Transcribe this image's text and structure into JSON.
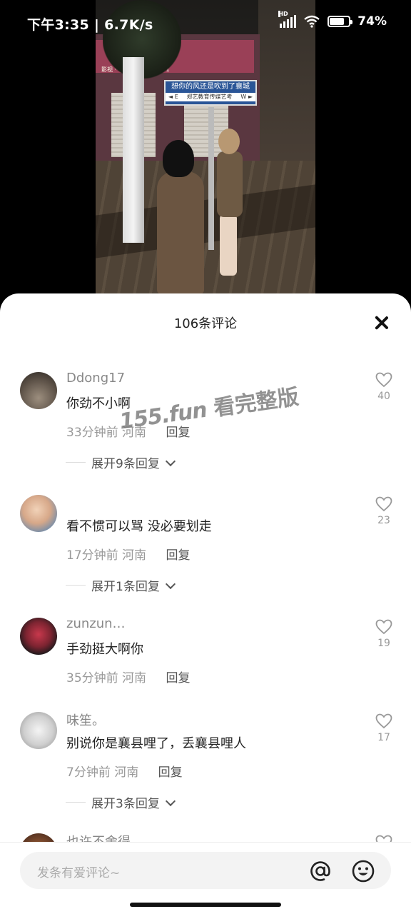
{
  "status_bar": {
    "time": "下午3:35",
    "network_speed": "6.7K/s",
    "signal_label": "HD",
    "battery_percent": "74%",
    "battery_level": 0.74
  },
  "video": {
    "shop_sign": "襄",
    "shop_sign_small": "影视 ·· 电话 6620 ·· 1551",
    "street_sign_main": "想你的风还是吹到了襄城",
    "street_sign_left": "◄ E",
    "street_sign_sub": "郑艺教育传媒艺考",
    "street_sign_right": "W ►"
  },
  "sheet": {
    "title": "106条评论"
  },
  "watermark": {
    "url": "155.fun",
    "text": " 看完整版"
  },
  "comments": [
    {
      "username": "Ddong17",
      "text": "你劲不小啊",
      "time": "33分钟前",
      "location": "河南",
      "reply": "回复",
      "likes": "40",
      "expand": "展开9条回复"
    },
    {
      "username": "",
      "text": "看不惯可以骂 没必要划走",
      "time": "17分钟前",
      "location": "河南",
      "reply": "回复",
      "likes": "23",
      "expand": "展开1条回复"
    },
    {
      "username": "zunzun…",
      "text": "手劲挺大啊你",
      "time": "35分钟前",
      "location": "河南",
      "reply": "回复",
      "likes": "19",
      "expand": ""
    },
    {
      "username": "味笙。",
      "text": "别说你是襄县哩了，丢襄县哩人",
      "time": "7分钟前",
      "location": "河南",
      "reply": "回复",
      "likes": "17",
      "expand": "展开3条回复"
    },
    {
      "username": "也许不舍得",
      "text": "",
      "time": "",
      "location": "",
      "reply": "",
      "likes": "",
      "expand": ""
    }
  ],
  "input": {
    "placeholder": "发条有爱评论~"
  },
  "icons": {
    "close": "close-icon",
    "heart": "heart-icon",
    "chevron": "chevron-down-icon",
    "at": "at-icon",
    "emoji": "emoji-icon"
  }
}
